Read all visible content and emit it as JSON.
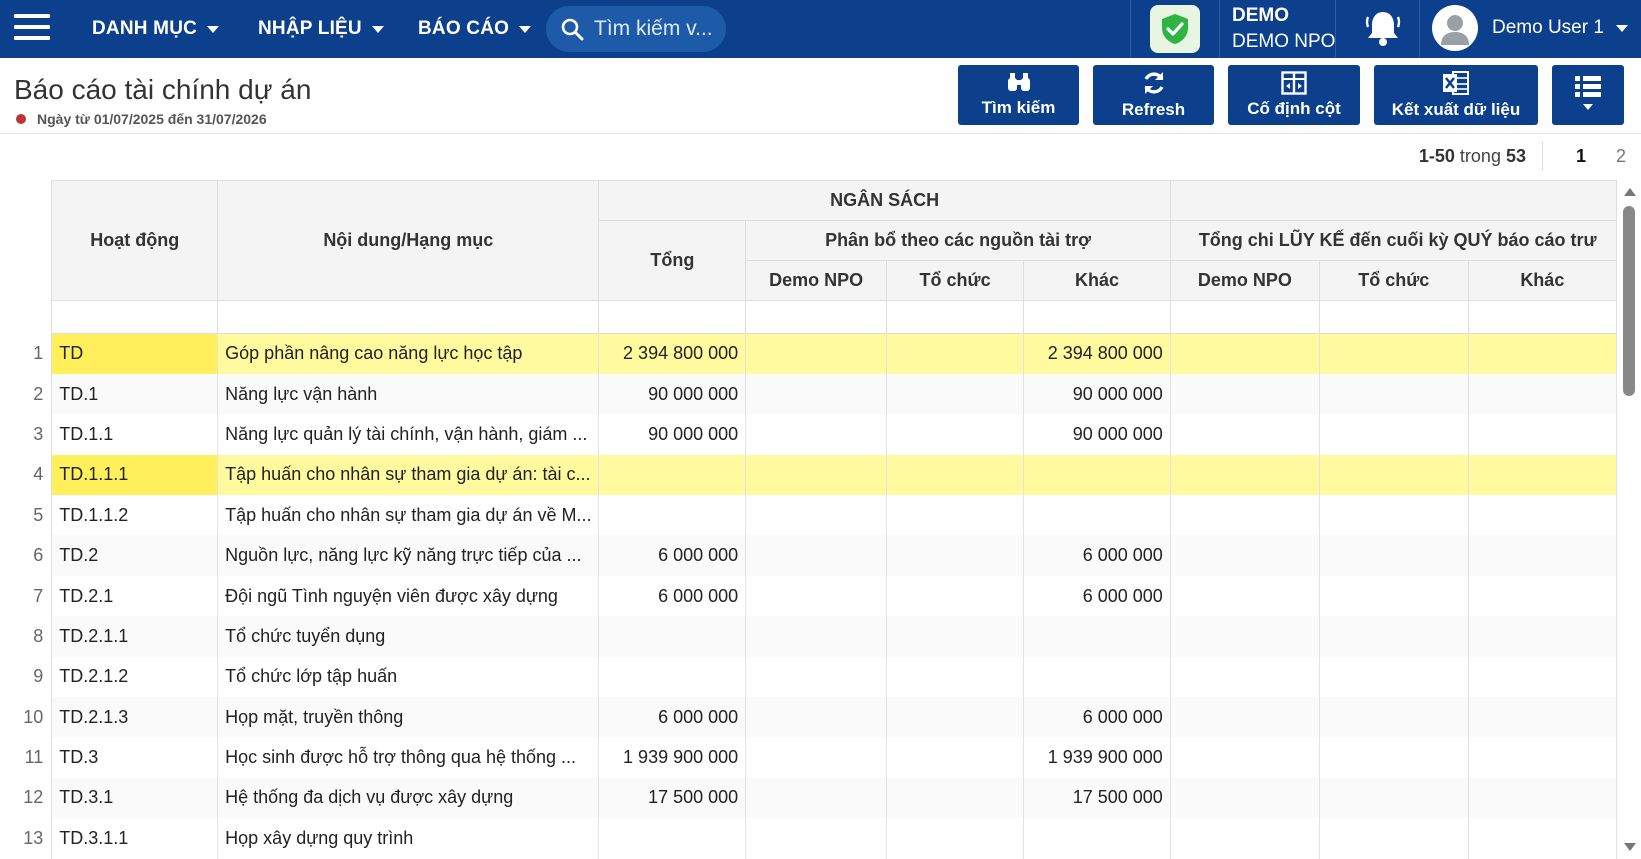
{
  "topbar": {
    "menus": [
      {
        "label": "DANH MỤC"
      },
      {
        "label": "NHẬP LIỆU"
      },
      {
        "label": "BÁO CÁO"
      }
    ],
    "search_placeholder": "Tìm kiếm v...",
    "org_code": "DEMO",
    "org_name": "DEMO NPO",
    "user_name": "Demo User 1"
  },
  "page": {
    "title": "Báo cáo tài chính dự án",
    "date_range": "Ngày từ 01/07/2025 đến 31/07/2026"
  },
  "toolbar": {
    "search_label": "Tìm kiếm",
    "refresh_label": "Refresh",
    "freeze_label": "Cố định cột",
    "export_label": "Kết xuất dữ liệu"
  },
  "pager": {
    "range": "1-50",
    "of_word": "trong",
    "total": "53",
    "pages": [
      "1",
      "2"
    ]
  },
  "table": {
    "headers": {
      "activity": "Hoạt động",
      "content": "Nội dung/Hạng mục",
      "budget": "NGÂN SÁCH",
      "total": "Tổng",
      "allocation": "Phân bổ theo các nguồn tài trợ",
      "cumulative": "Tổng chi LŨY KẾ đến cuối kỳ QUÝ báo cáo trư",
      "sub_demo_npo": "Demo NPO",
      "sub_org": "Tổ chức",
      "sub_other": "Khác"
    },
    "rows": [
      {
        "n": "1",
        "activity": "TD",
        "content": "Góp phần nâng cao năng lực học tập",
        "total": "2 394 800 000",
        "demo_npo": "",
        "org": "",
        "other": "2 394 800 000",
        "highlight": true
      },
      {
        "n": "2",
        "activity": "TD.1",
        "content": "Năng lực vận hành",
        "total": "90 000 000",
        "demo_npo": "",
        "org": "",
        "other": "90 000 000",
        "highlight": false
      },
      {
        "n": "3",
        "activity": "TD.1.1",
        "content": "Năng lực quản lý tài chính, vận hành, giám ...",
        "total": "90 000 000",
        "demo_npo": "",
        "org": "",
        "other": "90 000 000",
        "highlight": false
      },
      {
        "n": "4",
        "activity": "TD.1.1.1",
        "content": "Tập huấn cho nhân sự tham gia dự án: tài c...",
        "total": "",
        "demo_npo": "",
        "org": "",
        "other": "",
        "highlight": true
      },
      {
        "n": "5",
        "activity": "TD.1.1.2",
        "content": "Tập huấn cho nhân sự tham gia dự án về M...",
        "total": "",
        "demo_npo": "",
        "org": "",
        "other": "",
        "highlight": false
      },
      {
        "n": "6",
        "activity": "TD.2",
        "content": "Nguồn lực, năng lực kỹ năng trực tiếp của ...",
        "total": "6 000 000",
        "demo_npo": "",
        "org": "",
        "other": "6 000 000",
        "highlight": false
      },
      {
        "n": "7",
        "activity": "TD.2.1",
        "content": "Đội ngũ Tình nguyện viên được xây dựng",
        "total": "6 000 000",
        "demo_npo": "",
        "org": "",
        "other": "6 000 000",
        "highlight": false
      },
      {
        "n": "8",
        "activity": "TD.2.1.1",
        "content": "Tổ chức tuyển dụng",
        "total": "",
        "demo_npo": "",
        "org": "",
        "other": "",
        "highlight": false
      },
      {
        "n": "9",
        "activity": "TD.2.1.2",
        "content": "Tổ chức lớp tập huấn",
        "total": "",
        "demo_npo": "",
        "org": "",
        "other": "",
        "highlight": false
      },
      {
        "n": "10",
        "activity": "TD.2.1.3",
        "content": "Họp mặt, truyền thông",
        "total": "6 000 000",
        "demo_npo": "",
        "org": "",
        "other": "6 000 000",
        "highlight": false
      },
      {
        "n": "11",
        "activity": "TD.3",
        "content": "Học sinh được hỗ trợ thông qua hệ thống ...",
        "total": "1 939 900 000",
        "demo_npo": "",
        "org": "",
        "other": "1 939 900 000",
        "highlight": false
      },
      {
        "n": "12",
        "activity": "TD.3.1",
        "content": "Hệ thống đa dịch vụ được xây dựng",
        "total": "17 500 000",
        "demo_npo": "",
        "org": "",
        "other": "17 500 000",
        "highlight": false
      },
      {
        "n": "13",
        "activity": "TD.3.1.1",
        "content": "Họp xây dựng quy trình",
        "total": "",
        "demo_npo": "",
        "org": "",
        "other": "",
        "highlight": false
      }
    ]
  },
  "colors": {
    "topbar": "#0c3f8c",
    "highlight_row": "#fffa9e",
    "highlight_cell": "#ffef5a"
  }
}
